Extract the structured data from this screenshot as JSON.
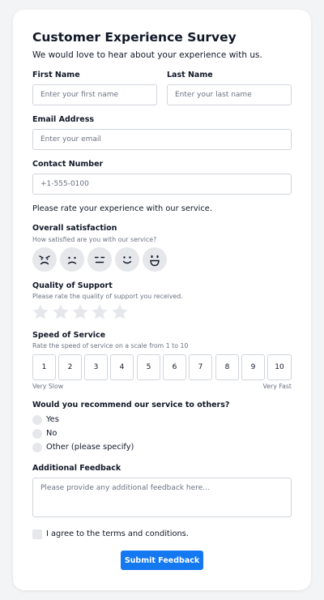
{
  "form": {
    "title": "Customer Experience Survey",
    "subtitle": "We would love to hear about your experience with us.",
    "first_name": {
      "label": "First Name",
      "placeholder": "Enter your first name",
      "value": ""
    },
    "last_name": {
      "label": "Last Name",
      "placeholder": "Enter your last name",
      "value": ""
    },
    "email": {
      "label": "Email Address",
      "placeholder": "Enter your email",
      "value": ""
    },
    "contact": {
      "label": "Contact Number",
      "placeholder": "+1-555-0100",
      "value": ""
    },
    "rating_intro": "Please rate your experience with our service.",
    "satisfaction": {
      "label": "Overall satisfaction",
      "hint": "How satisfied are you with our service?",
      "options": [
        "very-unsatisfied-face-icon",
        "unsatisfied-face-icon",
        "neutral-face-icon",
        "satisfied-face-icon",
        "very-satisfied-face-icon"
      ]
    },
    "support": {
      "label": "Quality of Support",
      "hint": "Please rate the quality of support you received.",
      "max_stars": 5,
      "selected_stars": 0
    },
    "speed": {
      "label": "Speed of Service",
      "hint": "Rate the speed of service on a scale from 1 to 10",
      "scale": [
        "1",
        "2",
        "3",
        "4",
        "5",
        "6",
        "7",
        "8",
        "9",
        "10"
      ],
      "min_label": "Very Slow",
      "max_label": "Very Fast"
    },
    "recommend": {
      "label": "Would you recommend our service to others?",
      "options": [
        "Yes",
        "No",
        "Other (please specify)"
      ]
    },
    "feedback": {
      "label": "Additional Feedback",
      "placeholder": "Please provide any additional feedback here...",
      "value": ""
    },
    "terms_label": "I agree to the terms and conditions.",
    "submit_label": "Submit Feedback"
  },
  "colors": {
    "accent": "#1478f0",
    "control_bg": "#e5e7eb",
    "star_empty": "#e5e7eb",
    "border": "#d1d5db"
  }
}
